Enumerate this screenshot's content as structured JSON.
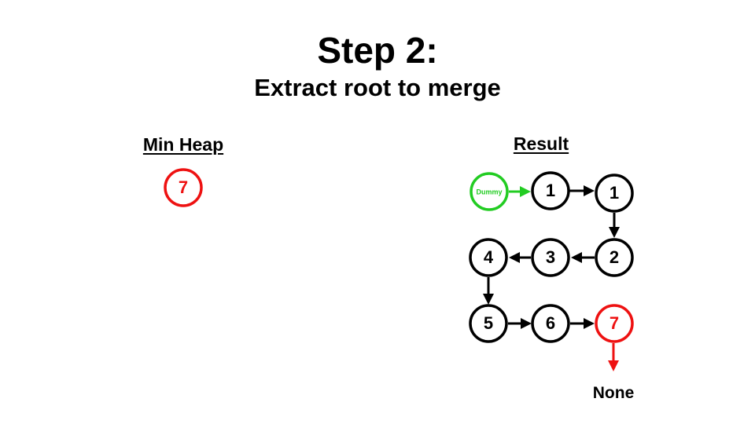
{
  "title": "Step 2:",
  "subtitle": "Extract root to merge",
  "heap": {
    "label": "Min Heap",
    "nodes": [
      "7"
    ]
  },
  "result": {
    "label": "Result",
    "dummy_label": "Dummy",
    "nodes": [
      "1",
      "1",
      "2",
      "3",
      "4",
      "5",
      "6",
      "7"
    ],
    "tail_label": "None"
  },
  "colors": {
    "default": "#000000",
    "dummy": "#22cc22",
    "highlight": "#ee1111"
  }
}
